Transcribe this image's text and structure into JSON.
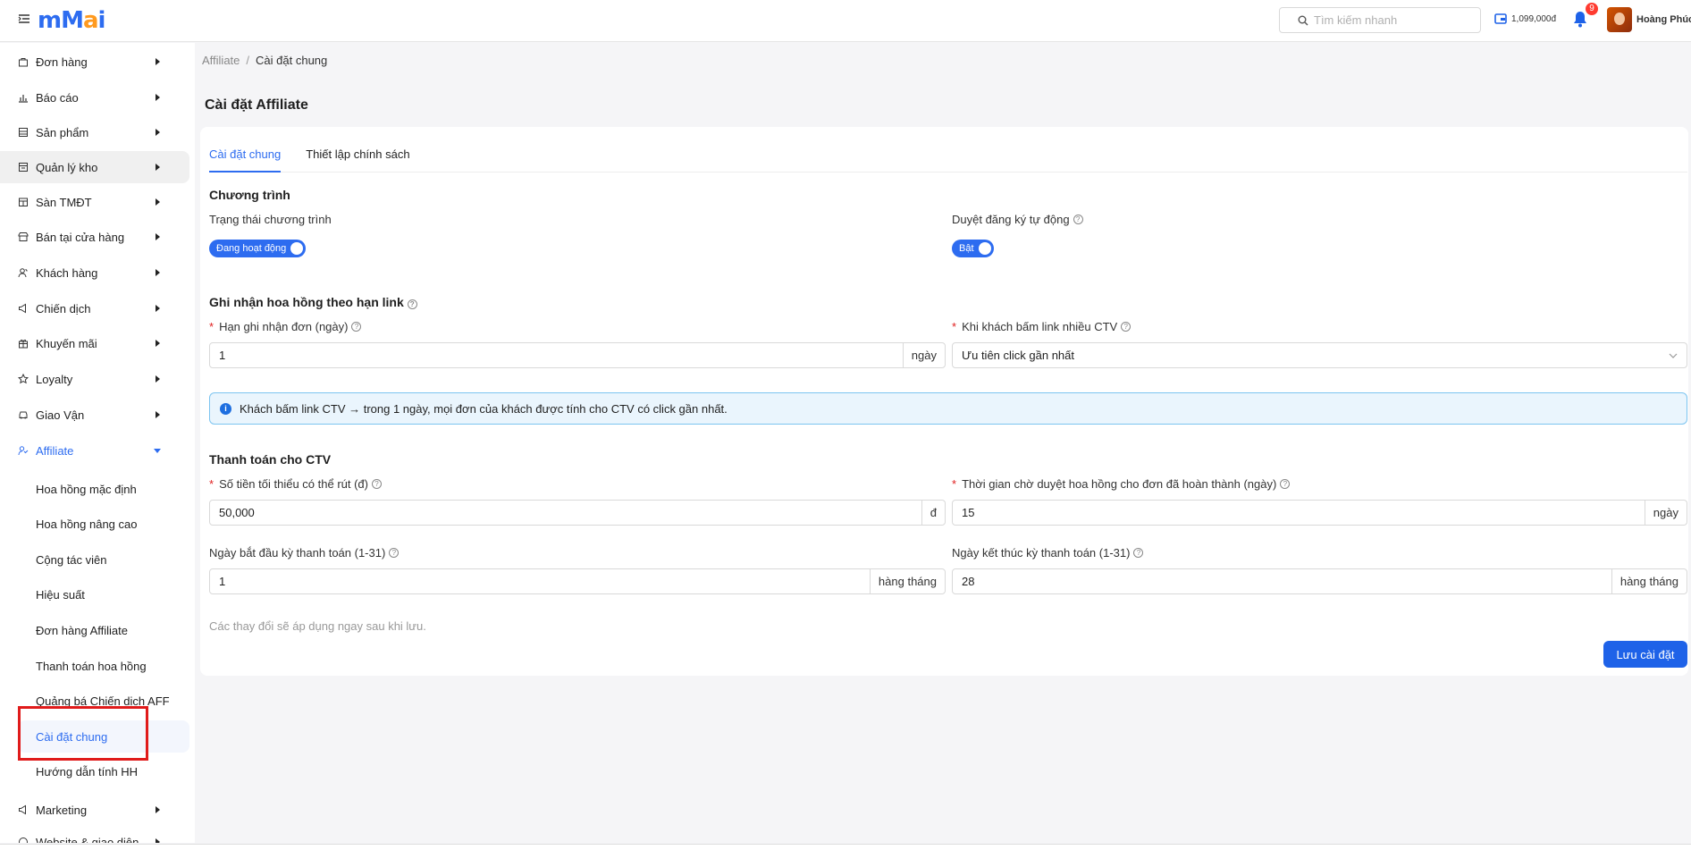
{
  "header": {
    "logo": "mMai",
    "search_placeholder": "Tìm kiếm nhanh",
    "wallet_balance": "1,099,000đ",
    "notification_count": "9",
    "user_name": "Hoàng Phúc"
  },
  "sidebar": {
    "items": [
      {
        "label": "Đơn hàng",
        "icon": "bag-icon"
      },
      {
        "label": "Báo cáo",
        "icon": "chart-icon"
      },
      {
        "label": "Sản phẩm",
        "icon": "product-icon"
      },
      {
        "label": "Quản lý kho",
        "icon": "warehouse-icon"
      },
      {
        "label": "Sàn TMĐT",
        "icon": "store-icon"
      },
      {
        "label": "Bán tại cửa hàng",
        "icon": "shop-icon"
      },
      {
        "label": "Khách hàng",
        "icon": "customer-icon"
      },
      {
        "label": "Chiến dịch",
        "icon": "megaphone-icon"
      },
      {
        "label": "Khuyến mãi",
        "icon": "gift-icon"
      },
      {
        "label": "Loyalty",
        "icon": "star-icon"
      },
      {
        "label": "Giao Vận",
        "icon": "car-icon"
      },
      {
        "label": "Affiliate",
        "icon": "affiliate-icon"
      }
    ],
    "affiliate_sub": [
      "Hoa hồng mặc định",
      "Hoa hồng nâng cao",
      "Cộng tác viên",
      "Hiệu suất",
      "Đơn hàng Affiliate",
      "Thanh toán hoa hồng",
      "Quảng bá Chiến dịch AFF",
      "Cài đặt chung",
      "Hướng dẫn tính HH"
    ],
    "after_items": [
      {
        "label": "Marketing",
        "icon": "marketing-icon"
      },
      {
        "label": "Website & giao diện",
        "icon": "website-icon"
      }
    ]
  },
  "breadcrumb": {
    "root": "Affiliate",
    "separator": "/",
    "current": "Cài đặt chung"
  },
  "page": {
    "title": "Cài đặt Affiliate",
    "tabs": [
      "Cài đặt chung",
      "Thiết lập chính sách"
    ],
    "program": {
      "title": "Chương trình",
      "status_label": "Trạng thái chương trình",
      "status_value": "Đang hoạt động",
      "auto_approve_label": "Duyệt đăng ký tự động",
      "auto_approve_value": "Bật"
    },
    "commission": {
      "title": "Ghi nhận hoa hồng theo hạn link",
      "deadline_label": "Hạn ghi nhận đơn (ngày)",
      "deadline_value": "1",
      "deadline_unit": "ngày",
      "multi_ctv_label": "Khi khách bấm link nhiều CTV",
      "multi_ctv_value": "Ưu tiên click gần nhất",
      "info": "Khách bấm link CTV → trong 1 ngày, mọi đơn của khách được tính cho CTV có click gần nhất."
    },
    "payment": {
      "title": "Thanh toán cho CTV",
      "min_withdraw_label": "Số tiền tối thiểu có thể rút (đ)",
      "min_withdraw_value": "50,000",
      "min_withdraw_unit": "đ",
      "wait_label": "Thời gian chờ duyệt hoa hồng cho đơn đã hoàn thành (ngày)",
      "wait_value": "15",
      "wait_unit": "ngày",
      "start_label": "Ngày bắt đầu kỳ thanh toán (1-31)",
      "start_value": "1",
      "start_unit": "hàng tháng",
      "end_label": "Ngày kết thúc kỳ thanh toán (1-31)",
      "end_value": "28",
      "end_unit": "hàng tháng"
    },
    "hint": "Các thay đổi sẽ áp dụng ngay sau khi lưu.",
    "save_label": "Lưu cài đặt"
  },
  "colors": {
    "accent": "#2d6cf0",
    "highlight": "#e01b1b",
    "info_bg": "#eaf5fd"
  }
}
